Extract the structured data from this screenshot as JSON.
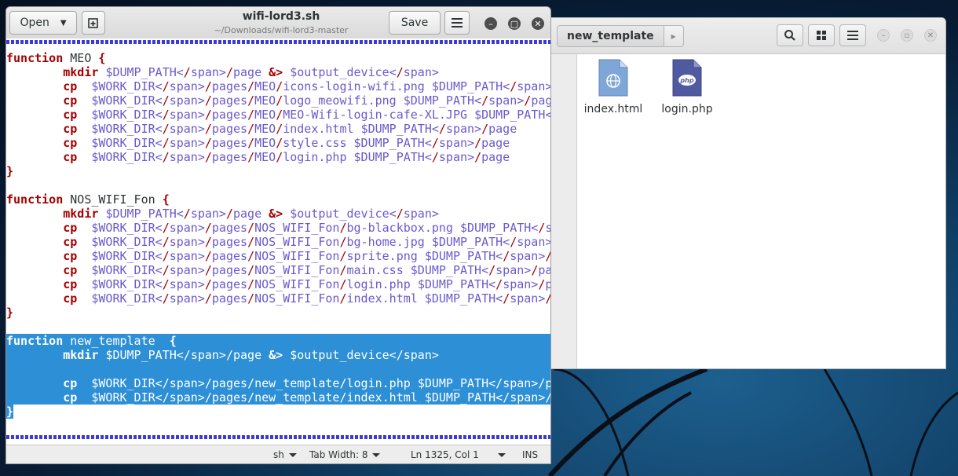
{
  "gedit": {
    "open_label": "Open",
    "save_label": "Save",
    "title": "wifi-lord3.sh",
    "subtitle": "~/Downloads/wifi-lord3-master"
  },
  "code": [
    {
      "kw": "function",
      "rest": " MEO ",
      "brace": "{"
    },
    {
      "indent": "        ",
      "kw": "mkdir",
      "rest": " $DUMP_PATH/page &> $output_device"
    },
    {
      "indent": "        ",
      "kw": "cp",
      "rest": "  $WORK_DIR/pages/MEO/icons-login-wifi.png $DUMP_PATH/page"
    },
    {
      "indent": "        ",
      "kw": "cp",
      "rest": "  $WORK_DIR/pages/MEO/logo_meowifi.png $DUMP_PATH/page"
    },
    {
      "indent": "        ",
      "kw": "cp",
      "rest": "  $WORK_DIR/pages/MEO/MEO-Wifi-login-cafe-XL.JPG $DUMP_PATH/page"
    },
    {
      "indent": "        ",
      "kw": "cp",
      "rest": "  $WORK_DIR/pages/MEO/index.html $DUMP_PATH/page"
    },
    {
      "indent": "        ",
      "kw": "cp",
      "rest": "  $WORK_DIR/pages/MEO/style.css $DUMP_PATH/page"
    },
    {
      "indent": "        ",
      "kw": "cp",
      "rest": "  $WORK_DIR/pages/MEO/login.php $DUMP_PATH/page"
    },
    {
      "kw": "",
      "brace": "}"
    },
    {
      "kw": ""
    },
    {
      "kw": "function",
      "rest": " NOS_WIFI_Fon ",
      "brace": "{"
    },
    {
      "indent": "        ",
      "kw": "mkdir",
      "rest": " $DUMP_PATH/page &> $output_device"
    },
    {
      "indent": "        ",
      "kw": "cp",
      "rest": "  $WORK_DIR/pages/NOS_WIFI_Fon/bg-blackbox.png $DUMP_PATH/page"
    },
    {
      "indent": "        ",
      "kw": "cp",
      "rest": "  $WORK_DIR/pages/NOS_WIFI_Fon/bg-home.jpg $DUMP_PATH/page"
    },
    {
      "indent": "        ",
      "kw": "cp",
      "rest": "  $WORK_DIR/pages/NOS_WIFI_Fon/sprite.png $DUMP_PATH/page"
    },
    {
      "indent": "        ",
      "kw": "cp",
      "rest": "  $WORK_DIR/pages/NOS_WIFI_Fon/main.css $DUMP_PATH/page"
    },
    {
      "indent": "        ",
      "kw": "cp",
      "rest": "  $WORK_DIR/pages/NOS_WIFI_Fon/login.php $DUMP_PATH/page"
    },
    {
      "indent": "        ",
      "kw": "cp",
      "rest": "  $WORK_DIR/pages/NOS_WIFI_Fon/index.html $DUMP_PATH/page"
    },
    {
      "kw": "",
      "brace": "}"
    },
    {
      "kw": ""
    },
    {
      "kw": "function",
      "rest": " new_template  ",
      "brace": "{",
      "sel": true
    },
    {
      "indent": "        ",
      "kw": "mkdir",
      "rest": " $DUMP_PATH/page &> $output_device",
      "sel": true
    },
    {
      "kw": "",
      "sel": true
    },
    {
      "indent": "        ",
      "kw": "cp",
      "rest": "  $WORK_DIR/pages/new_template/login.php $DUMP_PATH/page",
      "sel": true
    },
    {
      "indent": "        ",
      "kw": "cp",
      "rest": "  $WORK_DIR/pages/new_template/index.html $DUMP_PATH/page",
      "sel": true
    },
    {
      "kw": "",
      "brace": "}",
      "cursor": true
    }
  ],
  "statusbar": {
    "language": "sh",
    "tab_width": "Tab Width: 8",
    "position": "Ln 1325, Col 1",
    "mode": "INS"
  },
  "file_manager": {
    "breadcrumb": "new_template",
    "files": [
      {
        "name": "index.html",
        "icon": "html-file-icon"
      },
      {
        "name": "login.php",
        "icon": "php-file-icon"
      }
    ],
    "php_badge": "php"
  },
  "colors": {
    "keyword": "#a40000",
    "variable": "#6a5acd",
    "selection": "#2d8fd5"
  }
}
